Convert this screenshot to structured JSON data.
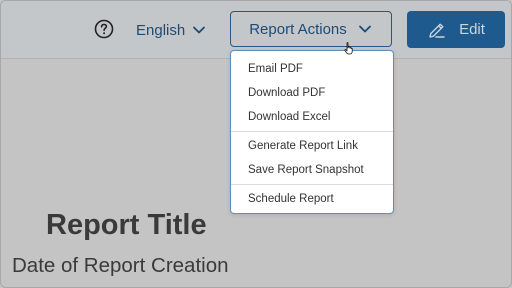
{
  "header": {
    "language_label": "English",
    "report_actions_label": "Report Actions",
    "edit_label": "Edit"
  },
  "menu": {
    "groups": [
      {
        "items": [
          "Email PDF",
          "Download PDF",
          "Download Excel"
        ]
      },
      {
        "items": [
          "Generate Report Link",
          "Save Report Snapshot"
        ]
      },
      {
        "items": [
          "Schedule Report"
        ]
      }
    ]
  },
  "report": {
    "title": "Report Title",
    "date": "Date of Report Creation"
  },
  "colors": {
    "accent": "#1f5a8e",
    "accent_text": "#1f4a74",
    "overlay_bg": "#c4c4c4",
    "menu_border": "#5a8fc0"
  },
  "icons": [
    "help-circle-icon",
    "chevron-down-icon",
    "chevron-down-icon",
    "pencil-icon",
    "hand-cursor-icon"
  ]
}
